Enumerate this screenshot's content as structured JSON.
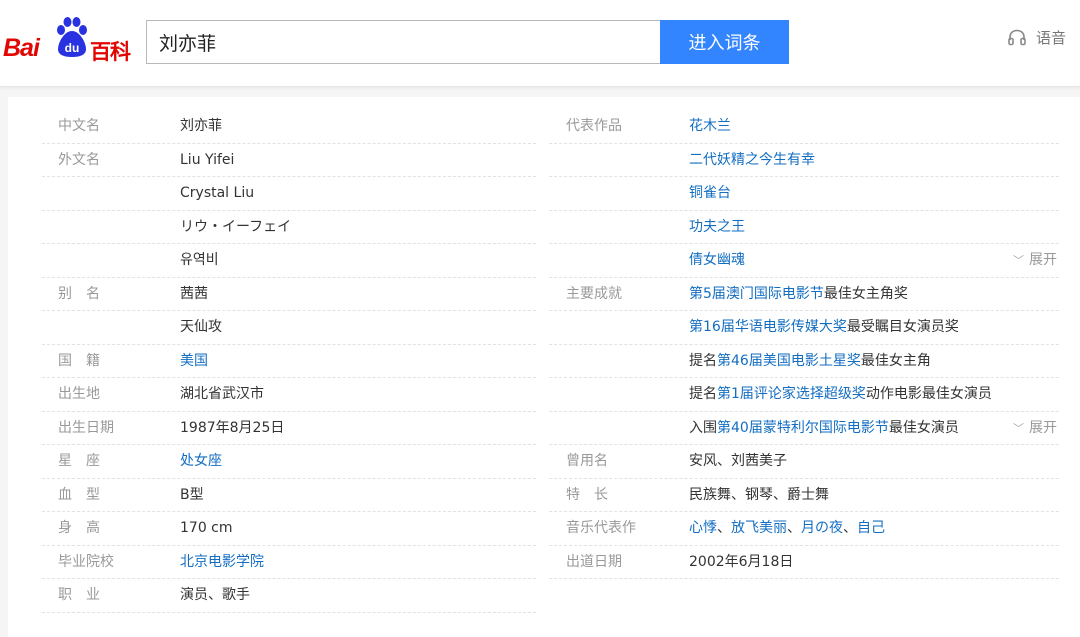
{
  "header": {
    "logo_bai": "Bai",
    "logo_du": "du",
    "logo_baike": "百科",
    "search_value": "刘亦菲",
    "enter_label": "进入词条",
    "voice_label": "语音"
  },
  "colors": {
    "brand_red": "#e10602",
    "paw_blue": "#2932e1",
    "button_blue": "#3385ff",
    "link_blue": "#136ec2",
    "label_gray": "#999999"
  },
  "left": [
    {
      "name": "中文名",
      "value": "刘亦菲"
    },
    {
      "name": "外文名",
      "value": "Liu Yifei"
    },
    {
      "name": "",
      "value": "Crystal Liu"
    },
    {
      "name": "",
      "value": "リウ・イーフェイ"
    },
    {
      "name": "",
      "value": "유역비"
    },
    {
      "name": "别　名",
      "value": "茜茜"
    },
    {
      "name": "",
      "value": "天仙攻"
    },
    {
      "name": "国　籍",
      "link": "美国"
    },
    {
      "name": "出生地",
      "value": "湖北省武汉市"
    },
    {
      "name": "出生日期",
      "value": "1987年8月25日"
    },
    {
      "name": "星　座",
      "link": "处女座"
    },
    {
      "name": "血　型",
      "value": "B型"
    },
    {
      "name": "身　高",
      "value": "170 cm"
    },
    {
      "name": "毕业院校",
      "link": "北京电影学院"
    },
    {
      "name": "职　业",
      "value": "演员、歌手"
    }
  ],
  "right": [
    {
      "name": "代表作品",
      "link": "花木兰"
    },
    {
      "name": "",
      "link": "二代妖精之今生有幸"
    },
    {
      "name": "",
      "link": "铜雀台"
    },
    {
      "name": "",
      "link": "功夫之王"
    },
    {
      "name": "",
      "link": "倩女幽魂",
      "expand": "展开"
    },
    {
      "name": "主要成就",
      "link": "第5届澳门国际电影节",
      "post": "最佳女主角奖"
    },
    {
      "name": "",
      "link": "第16届华语电影传媒大奖",
      "post": "最受瞩目女演员奖"
    },
    {
      "name": "",
      "pre": "提名",
      "link": "第46届美国电影土星奖",
      "post": "最佳女主角"
    },
    {
      "name": "",
      "pre": "提名",
      "link": "第1届评论家选择超级奖",
      "post": "动作电影最佳女演员"
    },
    {
      "name": "",
      "pre": "入围",
      "link": "第40届蒙特利尔国际电影节",
      "post": "最佳女演员",
      "expand": "展开"
    },
    {
      "name": "曾用名",
      "value": "安风、刘茜美子"
    },
    {
      "name": "特　长",
      "value": "民族舞、钢琴、爵士舞"
    },
    {
      "name": "音乐代表作",
      "links": [
        "心悸",
        "放飞美丽",
        "月の夜",
        "自己"
      ],
      "sep": "、"
    },
    {
      "name": "出道日期",
      "value": "2002年6月18日"
    }
  ]
}
